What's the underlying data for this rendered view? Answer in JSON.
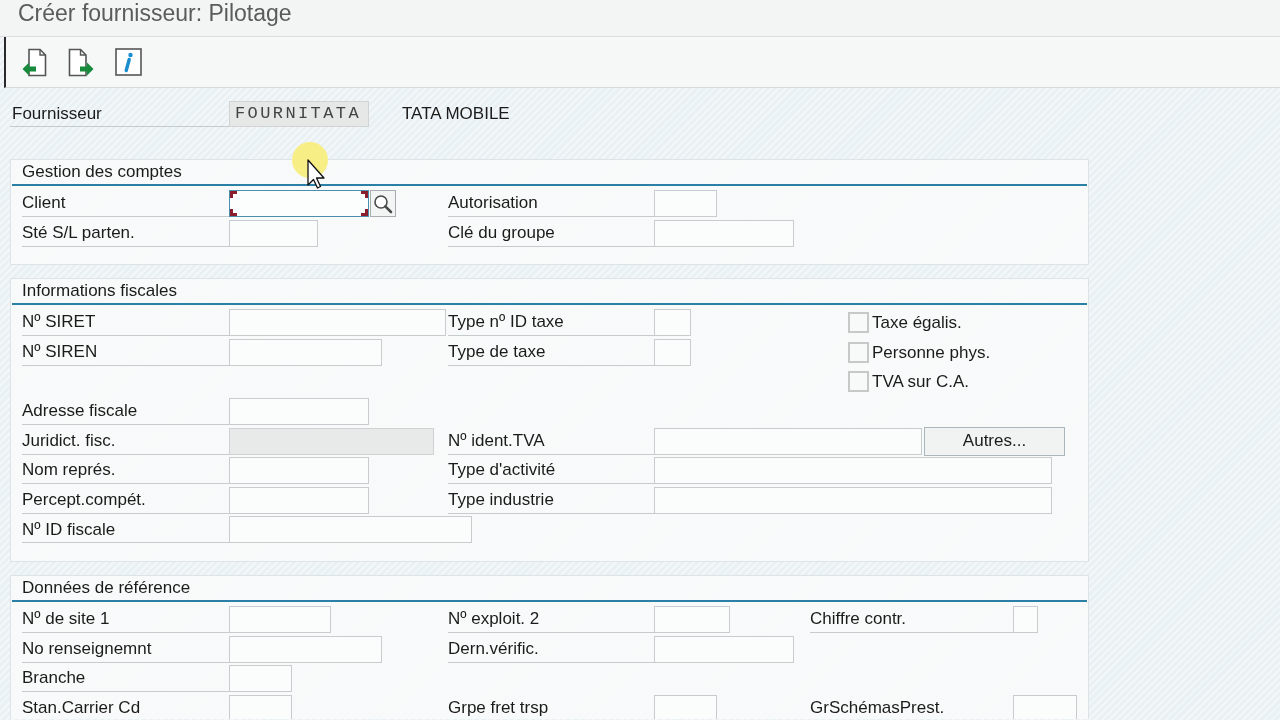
{
  "window": {
    "title": "Créer fournisseur: Pilotage"
  },
  "header": {
    "label": "Fournisseur",
    "value": "FOURNITATA",
    "description": "TATA MOBILE"
  },
  "sections": [
    {
      "title": "Gestion des comptes",
      "rows": [
        {
          "left": {
            "kind": "field",
            "label": "Client",
            "focused": true,
            "disabled": false,
            "search_help": true
          },
          "middle": {
            "kind": "field",
            "label": "Autorisation",
            "focused": false,
            "disabled": false,
            "search_help": false
          }
        },
        {
          "left": {
            "kind": "field",
            "label": "Sté S/L parten.",
            "focused": false,
            "disabled": false,
            "search_help": false
          },
          "middle": {
            "kind": "field",
            "label": "Clé du groupe",
            "focused": false,
            "disabled": false,
            "search_help": false
          }
        }
      ]
    },
    {
      "title": "Informations fiscales",
      "rows": [
        {
          "left": {
            "kind": "field",
            "label": "Nº SIRET",
            "focused": false,
            "disabled": false,
            "search_help": false
          },
          "middle": {
            "kind": "field",
            "label": "Type nº ID taxe",
            "focused": false,
            "disabled": false,
            "search_help": false
          },
          "right": {
            "kind": "checkbox",
            "label": "Taxe égalis.",
            "checked": false
          }
        },
        {
          "left": {
            "kind": "field",
            "label": "Nº SIREN",
            "focused": false,
            "disabled": false,
            "search_help": false
          },
          "middle": {
            "kind": "field",
            "label": "Type de taxe",
            "focused": false,
            "disabled": false,
            "search_help": false
          },
          "right": {
            "kind": "checkbox",
            "label": "Personne phys.",
            "checked": false
          }
        },
        {
          "right": {
            "kind": "checkbox",
            "label": "TVA sur C.A.",
            "checked": false
          }
        },
        {
          "left": {
            "kind": "field",
            "label": "Adresse fiscale",
            "focused": false,
            "disabled": false,
            "search_help": false
          }
        },
        {
          "left": {
            "kind": "field",
            "label": "Juridict. fisc.",
            "focused": false,
            "disabled": true,
            "search_help": false
          },
          "middle": {
            "kind": "field",
            "label": "Nº ident.TVA",
            "focused": false,
            "disabled": false,
            "search_help": false,
            "button": "Autres..."
          }
        },
        {
          "left": {
            "kind": "field",
            "label": "Nom représ.",
            "focused": false,
            "disabled": false,
            "search_help": false
          },
          "middle": {
            "kind": "field",
            "label": "Type d'activité",
            "focused": false,
            "disabled": false,
            "search_help": false
          }
        },
        {
          "left": {
            "kind": "field",
            "label": "Percept.compét.",
            "focused": false,
            "disabled": false,
            "search_help": false
          },
          "middle": {
            "kind": "field",
            "label": "Type industrie",
            "focused": false,
            "disabled": false,
            "search_help": false
          }
        },
        {
          "left": {
            "kind": "field",
            "label": "Nº ID fiscale",
            "focused": false,
            "disabled": false,
            "search_help": false
          }
        }
      ]
    },
    {
      "title": "Données de référence",
      "rows": [
        {
          "left": {
            "kind": "field",
            "label": "Nº de site 1",
            "focused": false,
            "disabled": false,
            "search_help": false
          },
          "middle": {
            "kind": "field",
            "label": "Nº exploit. 2",
            "focused": false,
            "disabled": false,
            "search_help": false
          },
          "right": {
            "kind": "field",
            "label": "Chiffre contr.",
            "focused": false,
            "disabled": false,
            "search_help": false
          }
        },
        {
          "left": {
            "kind": "field",
            "label": "No renseignemnt",
            "focused": false,
            "disabled": false,
            "search_help": false
          },
          "middle": {
            "kind": "field",
            "label": "Dern.vérific.",
            "focused": false,
            "disabled": false,
            "search_help": false
          }
        },
        {
          "left": {
            "kind": "field",
            "label": "Branche",
            "focused": false,
            "disabled": false,
            "search_help": false
          }
        },
        {
          "left": {
            "kind": "field",
            "label": "Stan.Carrier Cd",
            "focused": false,
            "disabled": false,
            "search_help": false
          },
          "middle": {
            "kind": "field",
            "label": "Grpe fret trsp",
            "focused": false,
            "disabled": false,
            "search_help": false
          },
          "right": {
            "kind": "field",
            "label": "GrSchémasPrest.",
            "focused": false,
            "disabled": false,
            "search_help": false
          }
        }
      ]
    }
  ]
}
